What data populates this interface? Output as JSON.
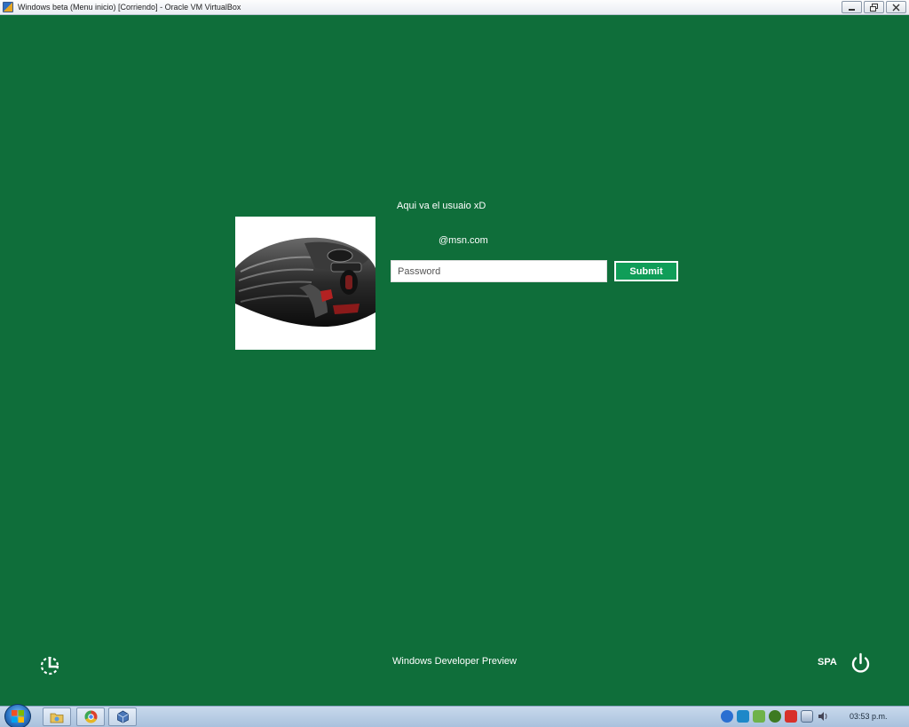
{
  "window": {
    "title": "Windows beta (Menu inicio) [Corriendo] - Oracle VM VirtualBox"
  },
  "login": {
    "username": "Aqui va el usuaio xD",
    "email": "@msn.com",
    "password_placeholder": "Password",
    "submit_label": "Submit"
  },
  "footer": {
    "product_text": "Windows Developer Preview",
    "language": "SPA"
  },
  "taskbar": {
    "clock": "03:53 p.m."
  },
  "colors": {
    "background": "#0f6e3a",
    "submit_button": "#0f9d58"
  },
  "icons": {
    "ease_of_access": "ease-of-access-icon",
    "power": "power-icon",
    "start": "windows-start-icon"
  }
}
